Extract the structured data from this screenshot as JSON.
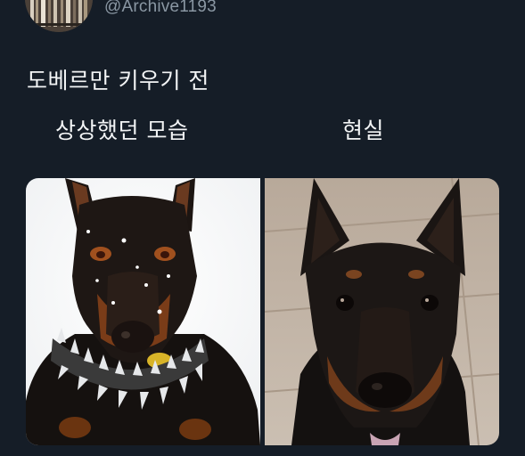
{
  "user": {
    "handle": "@Archive1193",
    "avatar_icon": "avatar-bookshelf-icon"
  },
  "tweet": {
    "text": "도베르만 키우기 전"
  },
  "comparison": {
    "left_label": "상상했던 모습",
    "right_label": "현실"
  },
  "media": {
    "left_image": "doberman-spiked-collar-snow-photo",
    "right_image": "doberman-indoor-photo"
  },
  "colors": {
    "background": "#151d27",
    "text": "#f2f4f5",
    "handle": "#8a97a3"
  }
}
